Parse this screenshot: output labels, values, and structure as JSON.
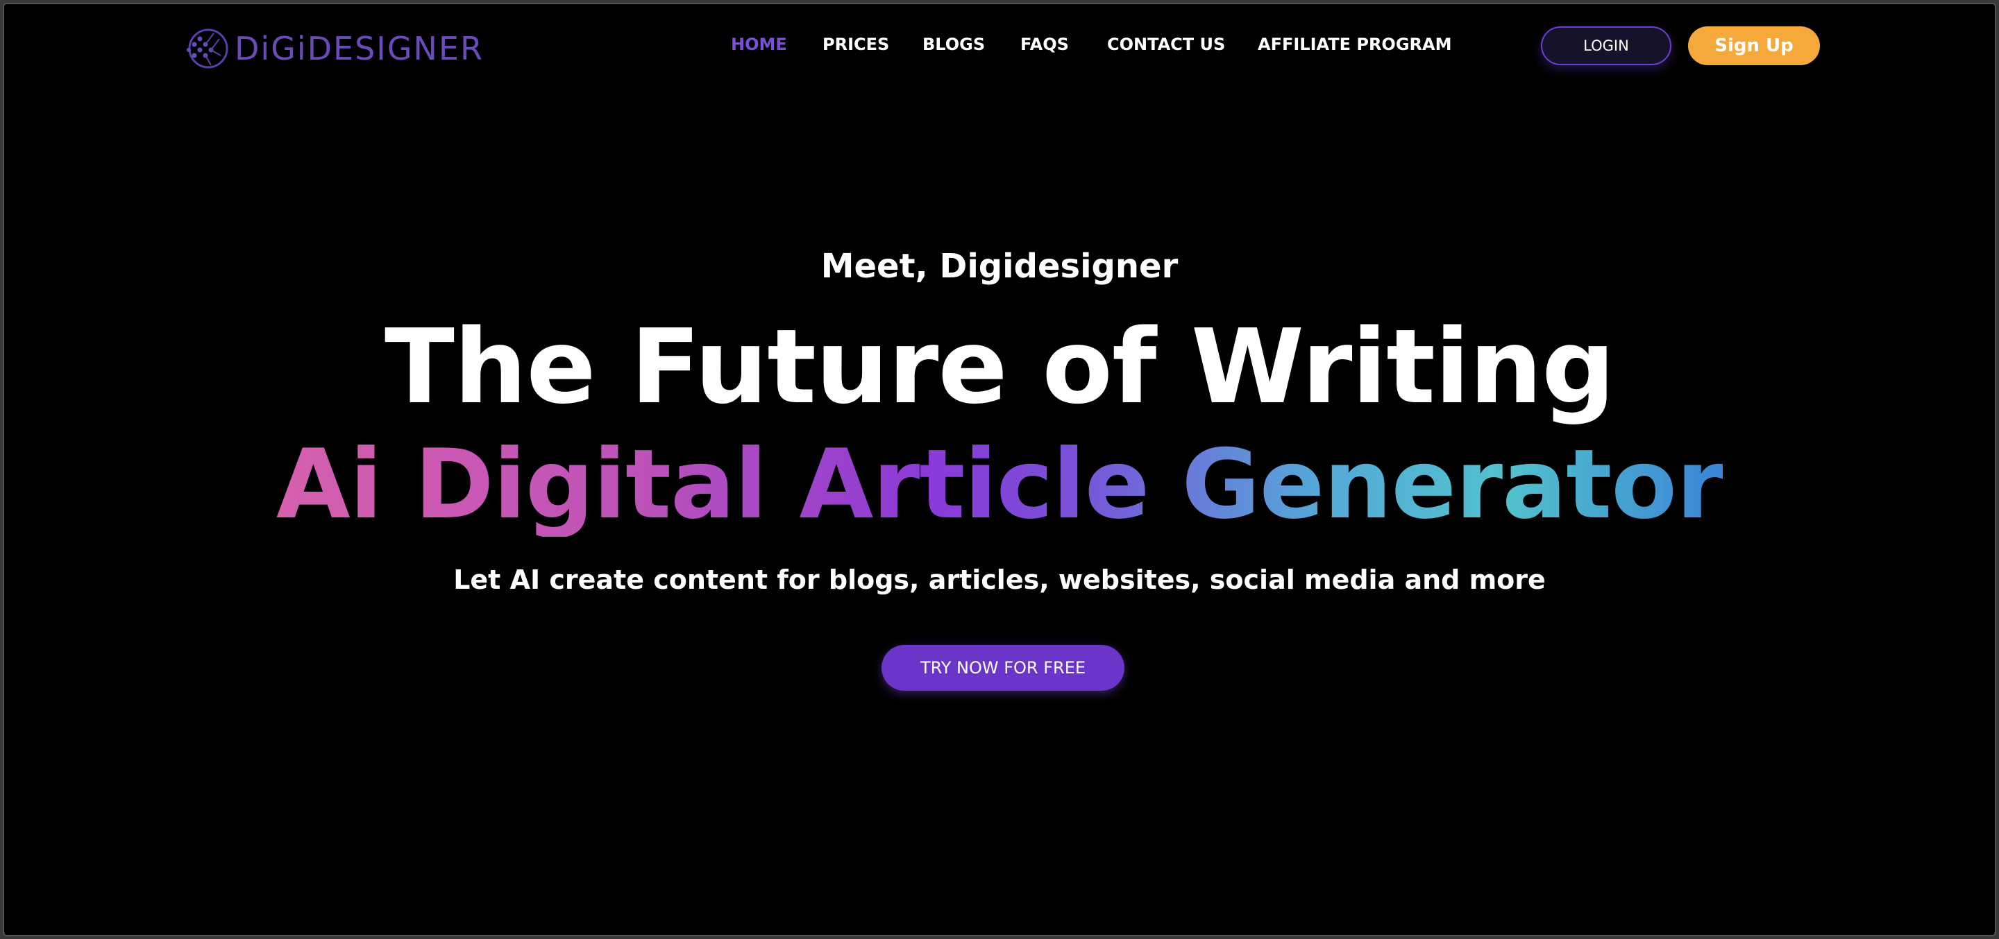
{
  "brand": {
    "name": "DiGiDESIGNER",
    "logo_icon": "globe-network-icon",
    "color": "#6a4bb8"
  },
  "nav": {
    "items": [
      {
        "label": "HOME",
        "active": true
      },
      {
        "label": "PRICES",
        "active": false
      },
      {
        "label": "BLOGS",
        "active": false
      },
      {
        "label": "FAQS",
        "active": false
      },
      {
        "label": "CONTACT US",
        "active": false
      },
      {
        "label": "AFFILIATE PROGRAM",
        "active": false
      }
    ]
  },
  "auth": {
    "login_label": "LOGIN",
    "signup_label": "Sign Up"
  },
  "hero": {
    "eyebrow": "Meet, Digidesigner",
    "headline": "The Future of Writing",
    "headline_gradient": "Ai Digital Article Generator",
    "subtitle": "Let AI create content for blogs, articles, websites, social media and more",
    "cta_label": "TRY NOW FOR FREE"
  },
  "colors": {
    "background": "#000000",
    "accent": "#6a35c8",
    "active_nav": "#7b4fdc",
    "signup": "#f4a93a"
  }
}
